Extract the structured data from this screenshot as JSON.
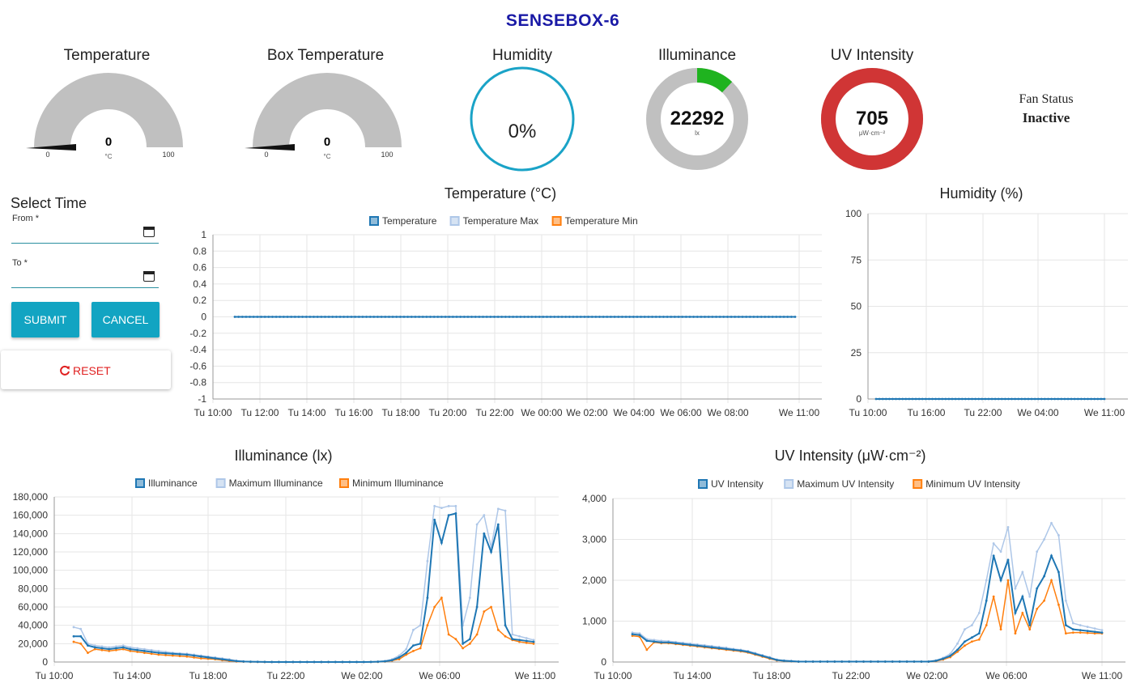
{
  "header": {
    "title": "SENSEBOX-6"
  },
  "gauges": {
    "temperature": {
      "title": "Temperature",
      "value": "0",
      "unit": "°C",
      "min": "0",
      "max": "100",
      "level": 0
    },
    "box_temperature": {
      "title": "Box Temperature",
      "value": "0",
      "unit": "°C",
      "min": "0",
      "max": "100",
      "level": 0
    },
    "humidity": {
      "title": "Humidity",
      "value": "0%",
      "level": 0,
      "color": "#1aa3c7"
    },
    "illuminance": {
      "title": "Illuminance",
      "value": "22292",
      "unit": "lx",
      "level": 0.12,
      "color": "#1fb31f"
    },
    "uv": {
      "title": "UV Intensity",
      "value": "705",
      "unit": "μW·cm⁻²",
      "level": 1.0,
      "color": "#d03535"
    },
    "fan": {
      "label": "Fan Status",
      "value": "Inactive"
    }
  },
  "time_select": {
    "title": "Select Time",
    "from_label": "From *",
    "to_label": "To *",
    "submit_label": "SUBMIT",
    "cancel_label": "CANCEL",
    "reset_label": "RESET",
    "reset_icon": "refresh-icon"
  },
  "colors": {
    "primary": "#1f77b4",
    "light": "#aec7e8",
    "orange": "#ff7f0e",
    "accent": "#12a4c2",
    "reset": "#e02020"
  },
  "chart_data": [
    {
      "id": "temperature",
      "type": "line",
      "title": "Temperature (°C)",
      "x_ticks": [
        "Tu 10:00",
        "Tu 12:00",
        "Tu 14:00",
        "Tu 16:00",
        "Tu 18:00",
        "Tu 20:00",
        "Tu 22:00",
        "We 00:00",
        "We 02:00",
        "We 04:00",
        "We 06:00",
        "We 08:00",
        "We 11:00"
      ],
      "y_ticks": [
        "1",
        "0.8",
        "0.6",
        "0.4",
        "0.2",
        "0",
        "-0.2",
        "-0.4",
        "-0.6",
        "-0.8",
        "-1"
      ],
      "ylim": [
        -1,
        1
      ],
      "grid": true,
      "legend": "top-center",
      "series": [
        {
          "name": "Temperature",
          "color": "#1f77b4",
          "values": [
            0,
            0
          ]
        },
        {
          "name": "Temperature Max",
          "color": "#aec7e8",
          "values": []
        },
        {
          "name": "Temperature Min",
          "color": "#ff7f0e",
          "values": []
        }
      ]
    },
    {
      "id": "humidity",
      "type": "line",
      "title": "Humidity (%)",
      "x_ticks": [
        "Tu 10:00",
        "Tu 16:00",
        "Tu 22:00",
        "We 04:00",
        "We 11:00"
      ],
      "y_ticks": [
        "100",
        "75",
        "50",
        "25",
        "0"
      ],
      "ylim": [
        0,
        100
      ],
      "grid": true,
      "series": [
        {
          "color": "#1f77b4",
          "values": [
            0,
            0
          ]
        }
      ]
    },
    {
      "id": "illuminance",
      "type": "line",
      "title": "Illuminance (lx)",
      "x_ticks": [
        "Tu 10:00",
        "Tu 14:00",
        "Tu 18:00",
        "Tu 22:00",
        "We 02:00",
        "We 06:00",
        "We 11:00"
      ],
      "y_ticks": [
        "180,000",
        "160,000",
        "140,000",
        "120,000",
        "100,000",
        "80,000",
        "60,000",
        "40,000",
        "20,000",
        "0"
      ],
      "ylim": [
        0,
        180000
      ],
      "grid": true,
      "legend": "top-center",
      "series": [
        {
          "name": "Illuminance",
          "color": "#1f77b4",
          "values": [
            28000,
            28000,
            18000,
            16000,
            15000,
            14000,
            15000,
            16000,
            14000,
            13000,
            12000,
            11000,
            10000,
            9500,
            9000,
            8500,
            8000,
            7000,
            6000,
            5000,
            4000,
            3000,
            2000,
            1000,
            500,
            300,
            200,
            100,
            50,
            50,
            50,
            50,
            50,
            50,
            50,
            50,
            50,
            50,
            50,
            50,
            50,
            50,
            100,
            300,
            800,
            2000,
            5000,
            10000,
            18000,
            20000,
            70000,
            155000,
            130000,
            160000,
            162000,
            20000,
            25000,
            60000,
            140000,
            120000,
            150000,
            40000,
            25000,
            24000,
            23000,
            22000
          ]
        },
        {
          "name": "Maximum Illuminance",
          "color": "#aec7e8",
          "values": [
            38000,
            36000,
            20000,
            18000,
            17000,
            16000,
            17000,
            18000,
            16000,
            15000,
            14000,
            13000,
            12000,
            11000,
            10000,
            9500,
            9000,
            8000,
            7000,
            6000,
            5000,
            4000,
            3000,
            1500,
            800,
            400,
            300,
            150,
            80,
            80,
            80,
            80,
            80,
            80,
            80,
            80,
            80,
            80,
            80,
            80,
            80,
            80,
            150,
            500,
            1200,
            3000,
            7000,
            14000,
            35000,
            40000,
            110000,
            170000,
            168000,
            170000,
            170000,
            40000,
            70000,
            150000,
            160000,
            125000,
            167000,
            165000,
            30000,
            28000,
            26000,
            24000
          ]
        },
        {
          "name": "Minimum Illuminance",
          "color": "#ff7f0e",
          "values": [
            22000,
            20000,
            10000,
            14000,
            13000,
            12000,
            13000,
            14000,
            12000,
            11000,
            10000,
            9000,
            8000,
            7500,
            7000,
            6500,
            6000,
            5000,
            4000,
            3500,
            3000,
            2000,
            1200,
            600,
            300,
            150,
            100,
            50,
            30,
            30,
            30,
            30,
            30,
            30,
            30,
            30,
            30,
            30,
            30,
            30,
            30,
            30,
            60,
            150,
            500,
            1500,
            3000,
            8000,
            12000,
            15000,
            40000,
            60000,
            70000,
            30000,
            25000,
            15000,
            20000,
            30000,
            55000,
            60000,
            35000,
            28000,
            24000,
            22000,
            21000,
            20000
          ]
        }
      ]
    },
    {
      "id": "uv",
      "type": "line",
      "title": "UV Intensity (μW·cm⁻²)",
      "x_ticks": [
        "Tu 10:00",
        "Tu 14:00",
        "Tu 18:00",
        "Tu 22:00",
        "We 02:00",
        "We 06:00",
        "We 11:00"
      ],
      "y_ticks": [
        "4,000",
        "3,000",
        "2,000",
        "1,000",
        "0"
      ],
      "ylim": [
        0,
        4000
      ],
      "grid": true,
      "legend": "top-center",
      "series": [
        {
          "name": "UV Intensity",
          "color": "#1f77b4",
          "values": [
            680,
            660,
            520,
            500,
            480,
            480,
            460,
            440,
            420,
            400,
            380,
            360,
            340,
            320,
            300,
            280,
            250,
            200,
            150,
            100,
            50,
            30,
            20,
            10,
            10,
            10,
            10,
            10,
            10,
            10,
            10,
            10,
            10,
            10,
            10,
            10,
            10,
            10,
            10,
            10,
            10,
            10,
            30,
            80,
            150,
            300,
            500,
            600,
            700,
            1500,
            2600,
            2000,
            2500,
            1200,
            1600,
            900,
            1800,
            2100,
            2600,
            2200,
            900,
            800,
            780,
            760,
            740,
            720
          ]
        },
        {
          "name": "Maximum UV Intensity",
          "color": "#aec7e8",
          "values": [
            720,
            700,
            560,
            540,
            520,
            510,
            490,
            470,
            450,
            430,
            410,
            390,
            370,
            350,
            320,
            300,
            270,
            220,
            170,
            120,
            60,
            40,
            30,
            15,
            15,
            15,
            15,
            15,
            15,
            15,
            15,
            15,
            15,
            15,
            15,
            15,
            15,
            15,
            15,
            15,
            15,
            15,
            40,
            100,
            200,
            450,
            800,
            900,
            1200,
            2000,
            2900,
            2700,
            3300,
            1800,
            2200,
            1600,
            2700,
            3000,
            3400,
            3100,
            1500,
            950,
            900,
            860,
            820,
            780
          ]
        },
        {
          "name": "Minimum UV Intensity",
          "color": "#ff7f0e",
          "values": [
            640,
            620,
            300,
            480,
            460,
            460,
            440,
            420,
            400,
            380,
            360,
            340,
            320,
            300,
            280,
            260,
            230,
            180,
            130,
            80,
            40,
            25,
            15,
            8,
            8,
            8,
            8,
            8,
            8,
            8,
            8,
            8,
            8,
            8,
            8,
            8,
            8,
            8,
            8,
            8,
            8,
            8,
            20,
            60,
            120,
            250,
            400,
            500,
            550,
            900,
            1600,
            800,
            2000,
            700,
            1200,
            800,
            1300,
            1500,
            2000,
            1400,
            700,
            720,
            720,
            710,
            700,
            700
          ]
        }
      ]
    }
  ]
}
